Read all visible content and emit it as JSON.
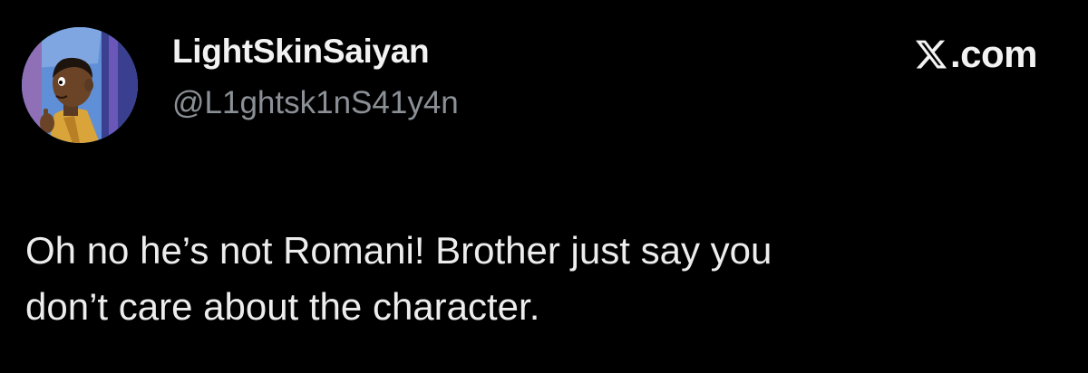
{
  "author": {
    "display_name": "LightSkinSaiyan",
    "handle": "@L1ghtsk1nS41y4n",
    "avatar_icon": "cartoon-avatar"
  },
  "brand": {
    "icon": "x-logo-icon",
    "domain_text": ".com"
  },
  "tweet": {
    "lines": [
      "Oh no he’s not Romani! Brother just say you",
      "don’t care about the character."
    ]
  },
  "colors": {
    "background": "#000000",
    "primary_text": "#e7e9ea",
    "secondary_text": "#8b9096"
  }
}
